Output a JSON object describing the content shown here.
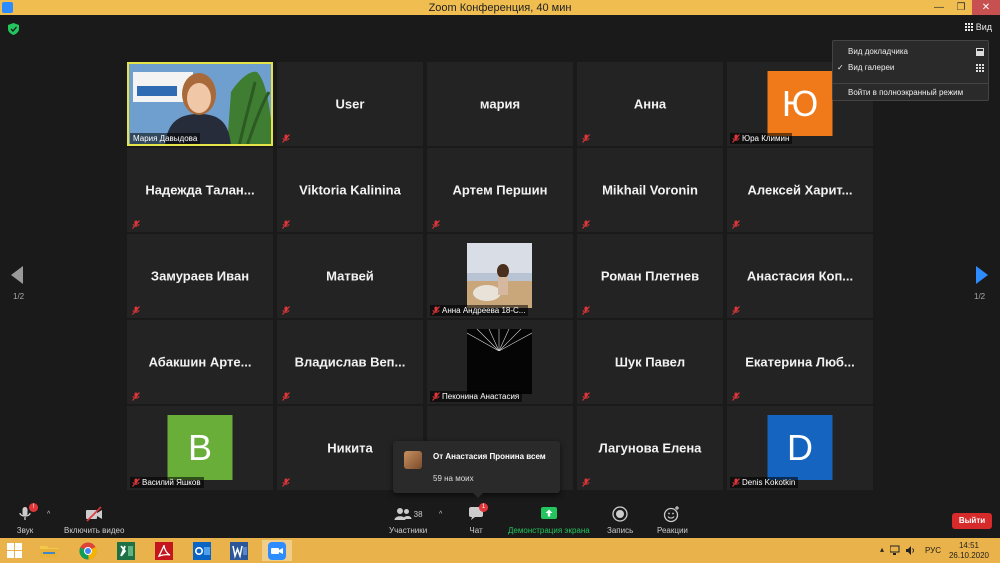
{
  "window": {
    "title": "Zoom Конференция, 40 мин",
    "minimize": "—",
    "maximize": "❐",
    "close": "✕"
  },
  "view_button": {
    "label": "Вид"
  },
  "view_menu": {
    "items": [
      {
        "label": "Вид докладчика",
        "checked": false,
        "icon": "speaker-view-icon"
      },
      {
        "label": "Вид галереи",
        "checked": true,
        "icon": "gallery-view-icon"
      },
      {
        "label": "Войти в полноэкранный режим",
        "checked": false
      }
    ]
  },
  "pagination": {
    "left": "1/2",
    "right": "1/2"
  },
  "participants": [
    {
      "name": "Мария Давыдова",
      "kind": "video",
      "speaking": true
    },
    {
      "name": "User",
      "kind": "name",
      "muted": true
    },
    {
      "name": "мария",
      "kind": "name"
    },
    {
      "name": "Анна",
      "kind": "name",
      "muted": true
    },
    {
      "name": "Юра Климин",
      "kind": "avatar",
      "initial": "Ю",
      "color": "#f07a1a",
      "muted": true
    },
    {
      "name": "Надежда Талан...",
      "kind": "name",
      "muted": true
    },
    {
      "name": "Viktoria Kalinina",
      "kind": "name",
      "muted": true
    },
    {
      "name": "Артем Першин",
      "kind": "name",
      "muted": true
    },
    {
      "name": "Mikhail Voronin",
      "kind": "name",
      "muted": true
    },
    {
      "name": "Алексей Харит...",
      "kind": "name",
      "muted": true
    },
    {
      "name": "Замураев Иван",
      "kind": "name",
      "muted": true
    },
    {
      "name": "Матвей",
      "kind": "name",
      "muted": true
    },
    {
      "name": "Анна Андреева 18-С...",
      "kind": "photo",
      "muted": true
    },
    {
      "name": "Роман Плетнев",
      "kind": "name",
      "muted": true
    },
    {
      "name": "Анастасия Коп...",
      "kind": "name",
      "muted": true
    },
    {
      "name": "Абакшин Арте...",
      "kind": "name",
      "muted": true
    },
    {
      "name": "Владислав Веп...",
      "kind": "name",
      "muted": true
    },
    {
      "name": "Пеконина Анастасия",
      "kind": "dark-photo",
      "muted": true
    },
    {
      "name": "Шук Павел",
      "kind": "name",
      "muted": true
    },
    {
      "name": "Екатерина Люб...",
      "kind": "name",
      "muted": true
    },
    {
      "name": "Василий Яшков",
      "kind": "avatar",
      "initial": "В",
      "color": "#6aae3a",
      "muted": true
    },
    {
      "name": "Никита",
      "kind": "name",
      "muted": true
    },
    {
      "name": "",
      "kind": "empty",
      "muted": false
    },
    {
      "name": "Лагунова Елена",
      "kind": "name",
      "muted": true
    },
    {
      "name": "Denis Kokotkin",
      "kind": "avatar",
      "initial": "D",
      "color": "#1565c0",
      "muted": true
    }
  ],
  "chat_toast": {
    "from": "От Анастасия Пронина всем",
    "message": "59 на моих"
  },
  "toolbar": {
    "audio": {
      "label": "Звук",
      "badge": "!"
    },
    "video": {
      "label": "Включить видео"
    },
    "participants": {
      "label": "Участники",
      "count": "38"
    },
    "chat": {
      "label": "Чат",
      "badge": "1"
    },
    "share": {
      "label": "Демонстрация экрана"
    },
    "record": {
      "label": "Запись"
    },
    "reactions": {
      "label": "Реакции"
    },
    "leave": {
      "label": "Выйти"
    }
  },
  "taskbar": {
    "apps": [
      "file-explorer-icon",
      "chrome-icon",
      "excel-icon",
      "acrobat-icon",
      "outlook-icon",
      "word-icon",
      "zoom-icon"
    ],
    "language": "РУС",
    "time": "14:51",
    "date": "26.10.2020"
  },
  "colors": {
    "accent": "#2d8cff",
    "speaker_border": "#e6e34a",
    "titlebar": "#f0bd50",
    "taskbar": "#e9b24a",
    "leave": "#d72a2a",
    "share": "#23c55e"
  }
}
